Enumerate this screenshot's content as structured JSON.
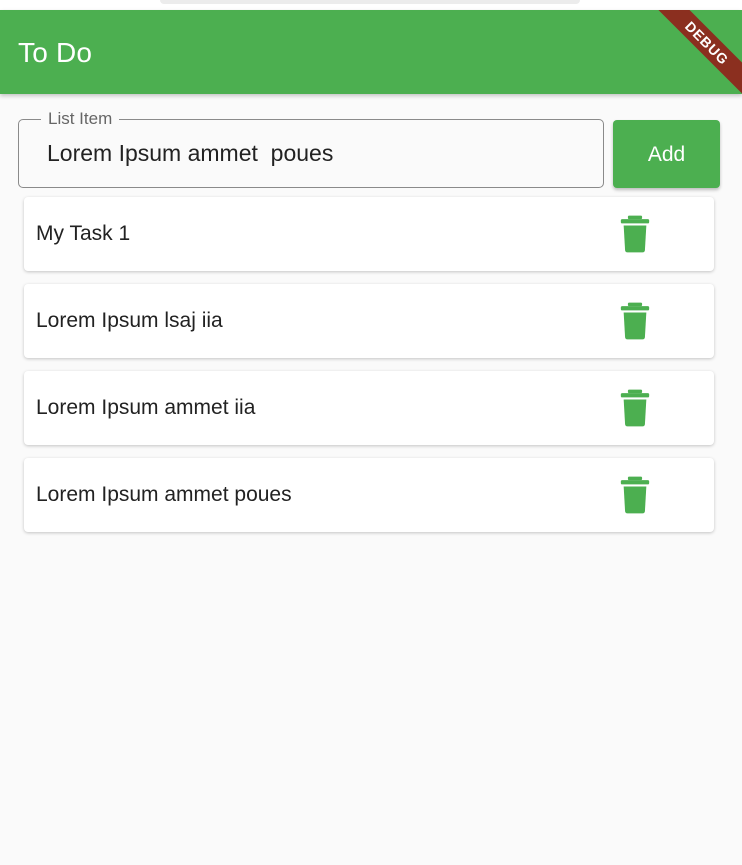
{
  "app_bar": {
    "title": "To Do",
    "debug_label": "DEBUG"
  },
  "input": {
    "label": "List Item",
    "value": "Lorem Ipsum ammet  poues"
  },
  "add_button": {
    "label": "Add"
  },
  "tasks": [
    {
      "text": "My Task 1"
    },
    {
      "text": "Lorem Ipsum lsaj iia"
    },
    {
      "text": "Lorem Ipsum ammet  iia"
    },
    {
      "text": "Lorem Ipsum ammet  poues"
    }
  ],
  "icons": {
    "delete": "trash-icon"
  },
  "colors": {
    "primary": "#4caf50",
    "debug_ribbon": "#8b2f1f",
    "background": "#fafafa"
  }
}
